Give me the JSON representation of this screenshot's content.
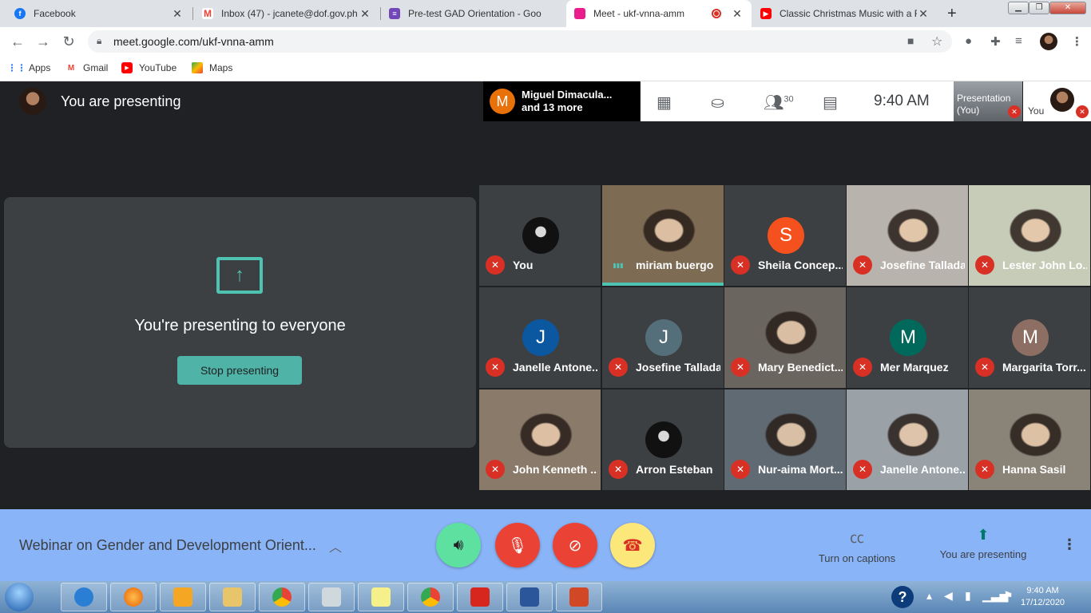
{
  "tabs": [
    {
      "title": "Facebook",
      "icon": "facebook-icon",
      "color": "#1877f2"
    },
    {
      "title": "Inbox (47) - jcanete@dof.gov.ph",
      "icon": "gmail-icon",
      "color": "#ea4335"
    },
    {
      "title": "Pre-test GAD Orientation - Goo",
      "icon": "forms-icon",
      "color": "#7248b9"
    },
    {
      "title": "Meet - ukf-vnna-amm",
      "icon": "meet-icon",
      "color": "#e91e8c"
    },
    {
      "title": "Classic Christmas Music with a F",
      "icon": "youtube-icon",
      "color": "#ff0000"
    }
  ],
  "address": {
    "url": "meet.google.com/ukf-vnna-amm"
  },
  "bookmarks": [
    {
      "label": "Apps",
      "icon": "apps-grid-icon"
    },
    {
      "label": "Gmail",
      "icon": "gmail-icon"
    },
    {
      "label": "YouTube",
      "icon": "youtube-icon"
    },
    {
      "label": "Maps",
      "icon": "maps-icon"
    }
  ],
  "meet": {
    "presenting_label": "You are presenting",
    "others_avatar_letter": "M",
    "others_line1": "Miguel Dimacula...",
    "others_line2": "and 13 more",
    "participant_count": "30",
    "time": "9:40  AM",
    "presentation_thumb_label": "Presentation (You)",
    "you_thumb_label": "You",
    "present_card": {
      "message": "You're presenting to everyone",
      "stop_button": "Stop presenting"
    },
    "participants": [
      {
        "name": "You",
        "type": "avatar",
        "bg": "#3c4043"
      },
      {
        "name": "miriam buergo",
        "type": "video",
        "bg": "#7d6b54",
        "speaking": true
      },
      {
        "name": "Sheila Concep...",
        "type": "letter",
        "letter": "S",
        "letter_bg": "#f4511e",
        "bg": "#3c4043"
      },
      {
        "name": "Josefine Tallada",
        "type": "video",
        "bg": "#b8b4ad"
      },
      {
        "name": "Lester John Lo...",
        "type": "video",
        "bg": "#c7ccb8"
      },
      {
        "name": "Janelle Antone...",
        "type": "letter",
        "letter": "J",
        "letter_bg": "#0b57a0",
        "bg": "#3c4043"
      },
      {
        "name": "Josefine Tallada",
        "type": "letter",
        "letter": "J",
        "letter_bg": "#546e7a",
        "bg": "#3c4043"
      },
      {
        "name": "Mary Benedict...",
        "type": "video",
        "bg": "#6b6560"
      },
      {
        "name": "Mer Marquez",
        "type": "letter",
        "letter": "M",
        "letter_bg": "#00695c",
        "bg": "#3c4043"
      },
      {
        "name": "Margarita Torr...",
        "type": "letter",
        "letter": "M",
        "letter_bg": "#8d6e63",
        "bg": "#3c4043"
      },
      {
        "name": "John Kenneth ...",
        "type": "video",
        "bg": "#8a7a6a"
      },
      {
        "name": "Arron Esteban",
        "type": "avatar",
        "bg": "#3c4043"
      },
      {
        "name": "Nur-aima Mort...",
        "type": "video",
        "bg": "#5f6a73"
      },
      {
        "name": "Janelle Antone...",
        "type": "video",
        "bg": "#9aa2a8"
      },
      {
        "name": "Hanna Sasil",
        "type": "video",
        "bg": "#8a8378"
      }
    ]
  },
  "bottom": {
    "meeting_title": "Webinar on Gender and Development Orient...",
    "captions_label": "Turn on captions",
    "presenting_label": "You are presenting"
  },
  "taskbar": {
    "time": "9:40 AM",
    "date": "17/12/2020"
  }
}
